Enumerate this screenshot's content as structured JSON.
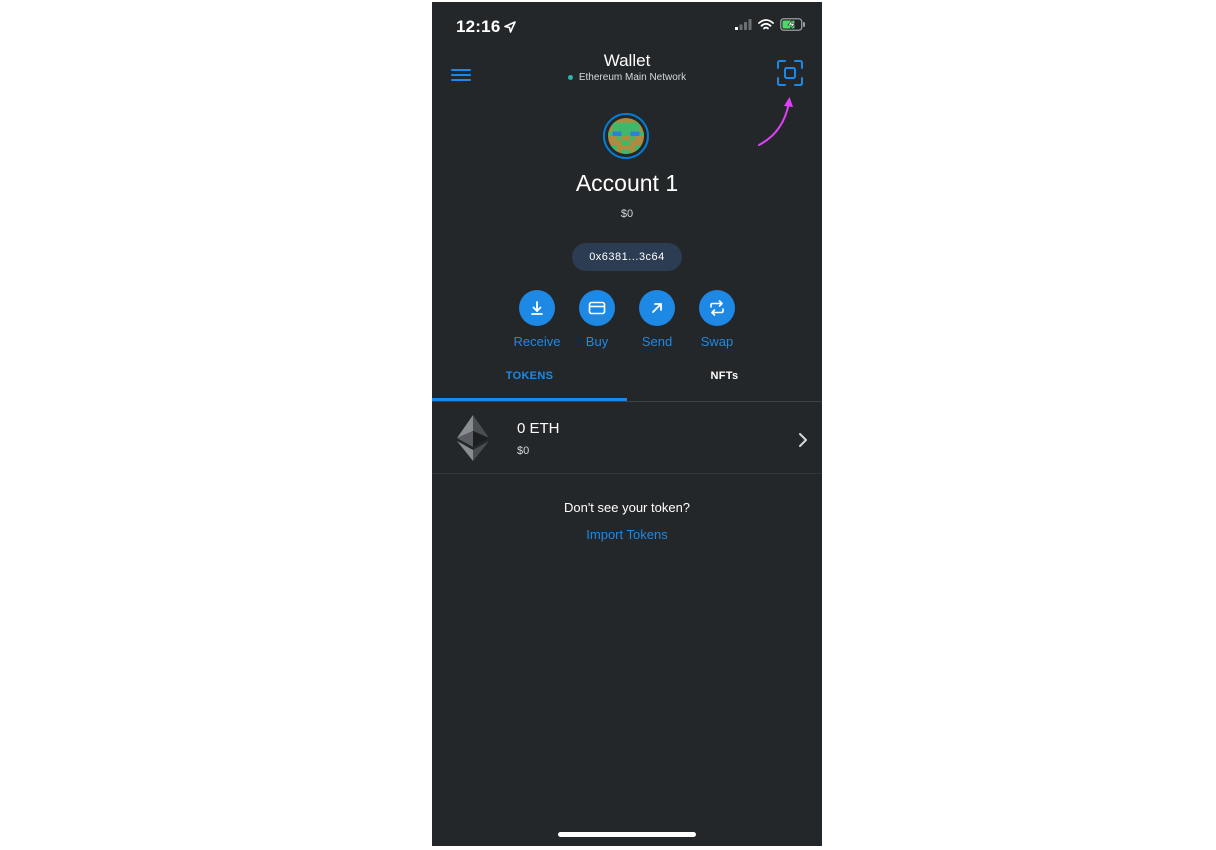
{
  "status_bar": {
    "time": "12:16"
  },
  "header": {
    "title": "Wallet",
    "network": "Ethereum Main Network"
  },
  "account": {
    "name": "Account 1",
    "balance": "$0",
    "address": "0x6381...3c64"
  },
  "actions": [
    {
      "label": "Receive",
      "icon": "receive-icon"
    },
    {
      "label": "Buy",
      "icon": "card-icon"
    },
    {
      "label": "Send",
      "icon": "send-arrow-icon"
    },
    {
      "label": "Swap",
      "icon": "swap-icon"
    }
  ],
  "tabs": [
    {
      "label": "TOKENS",
      "active": true
    },
    {
      "label": "NFTs",
      "active": false
    }
  ],
  "tokens": [
    {
      "amount": "0 ETH",
      "fiat": "$0",
      "icon": "ethereum-icon"
    }
  ],
  "import_prompt": {
    "text": "Don't see your token?",
    "link": "Import Tokens"
  },
  "colors": {
    "background": "#24272a",
    "accent": "#1e88e5",
    "annotation": "#e040fb",
    "network_dot": "#29b6af"
  }
}
